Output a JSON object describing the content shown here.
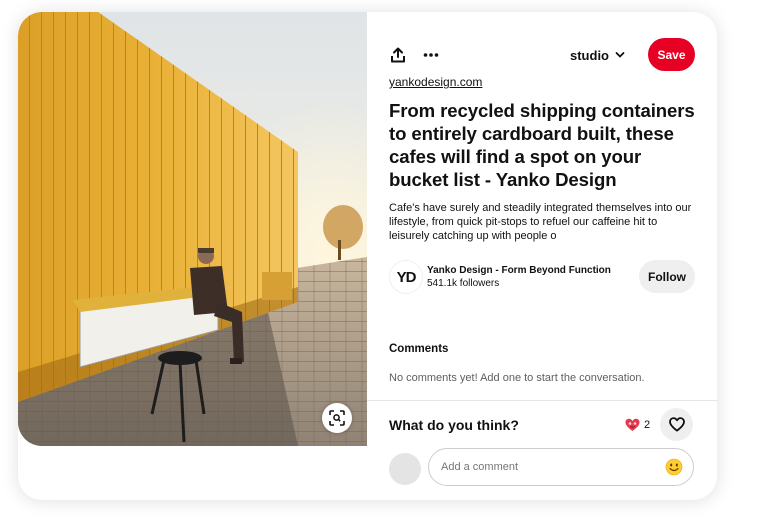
{
  "pin": {
    "source": "yankodesign.com",
    "title": "From recycled shipping containers to entirely cardboard built, these cafes will find a spot on your bucket list - Yanko Design",
    "description": "Cafe's have surely and steadily integrated themselves into our lifestyle, from quick pit-stops to refuel our caffeine hit to leisurely catching up with people o"
  },
  "toolbar": {
    "share_icon": "share-icon",
    "more_icon": "more-options-icon",
    "board_name": "studio",
    "board_chevron": "chevron-down-icon",
    "save_label": "Save"
  },
  "creator": {
    "avatar_text": "YD",
    "name": "Yanko Design - Form Beyond Function",
    "followers": "541.1k followers",
    "follow_label": "Follow"
  },
  "comments": {
    "title": "Comments",
    "empty_text": "No comments yet! Add one to start the conversation."
  },
  "feedback": {
    "prompt": "What do you think?",
    "reaction_icon": "heart-eyes-icon",
    "reaction_count": "2",
    "like_icon": "heart-outline-icon"
  },
  "composer": {
    "placeholder": "Add a comment",
    "emoji_icon": "smiley-emoji-icon"
  },
  "image": {
    "lens_icon": "visual-search-icon"
  },
  "colors": {
    "save_red": "#e60023",
    "button_gray": "#efefef",
    "wood_yellow": "#e9a925"
  }
}
